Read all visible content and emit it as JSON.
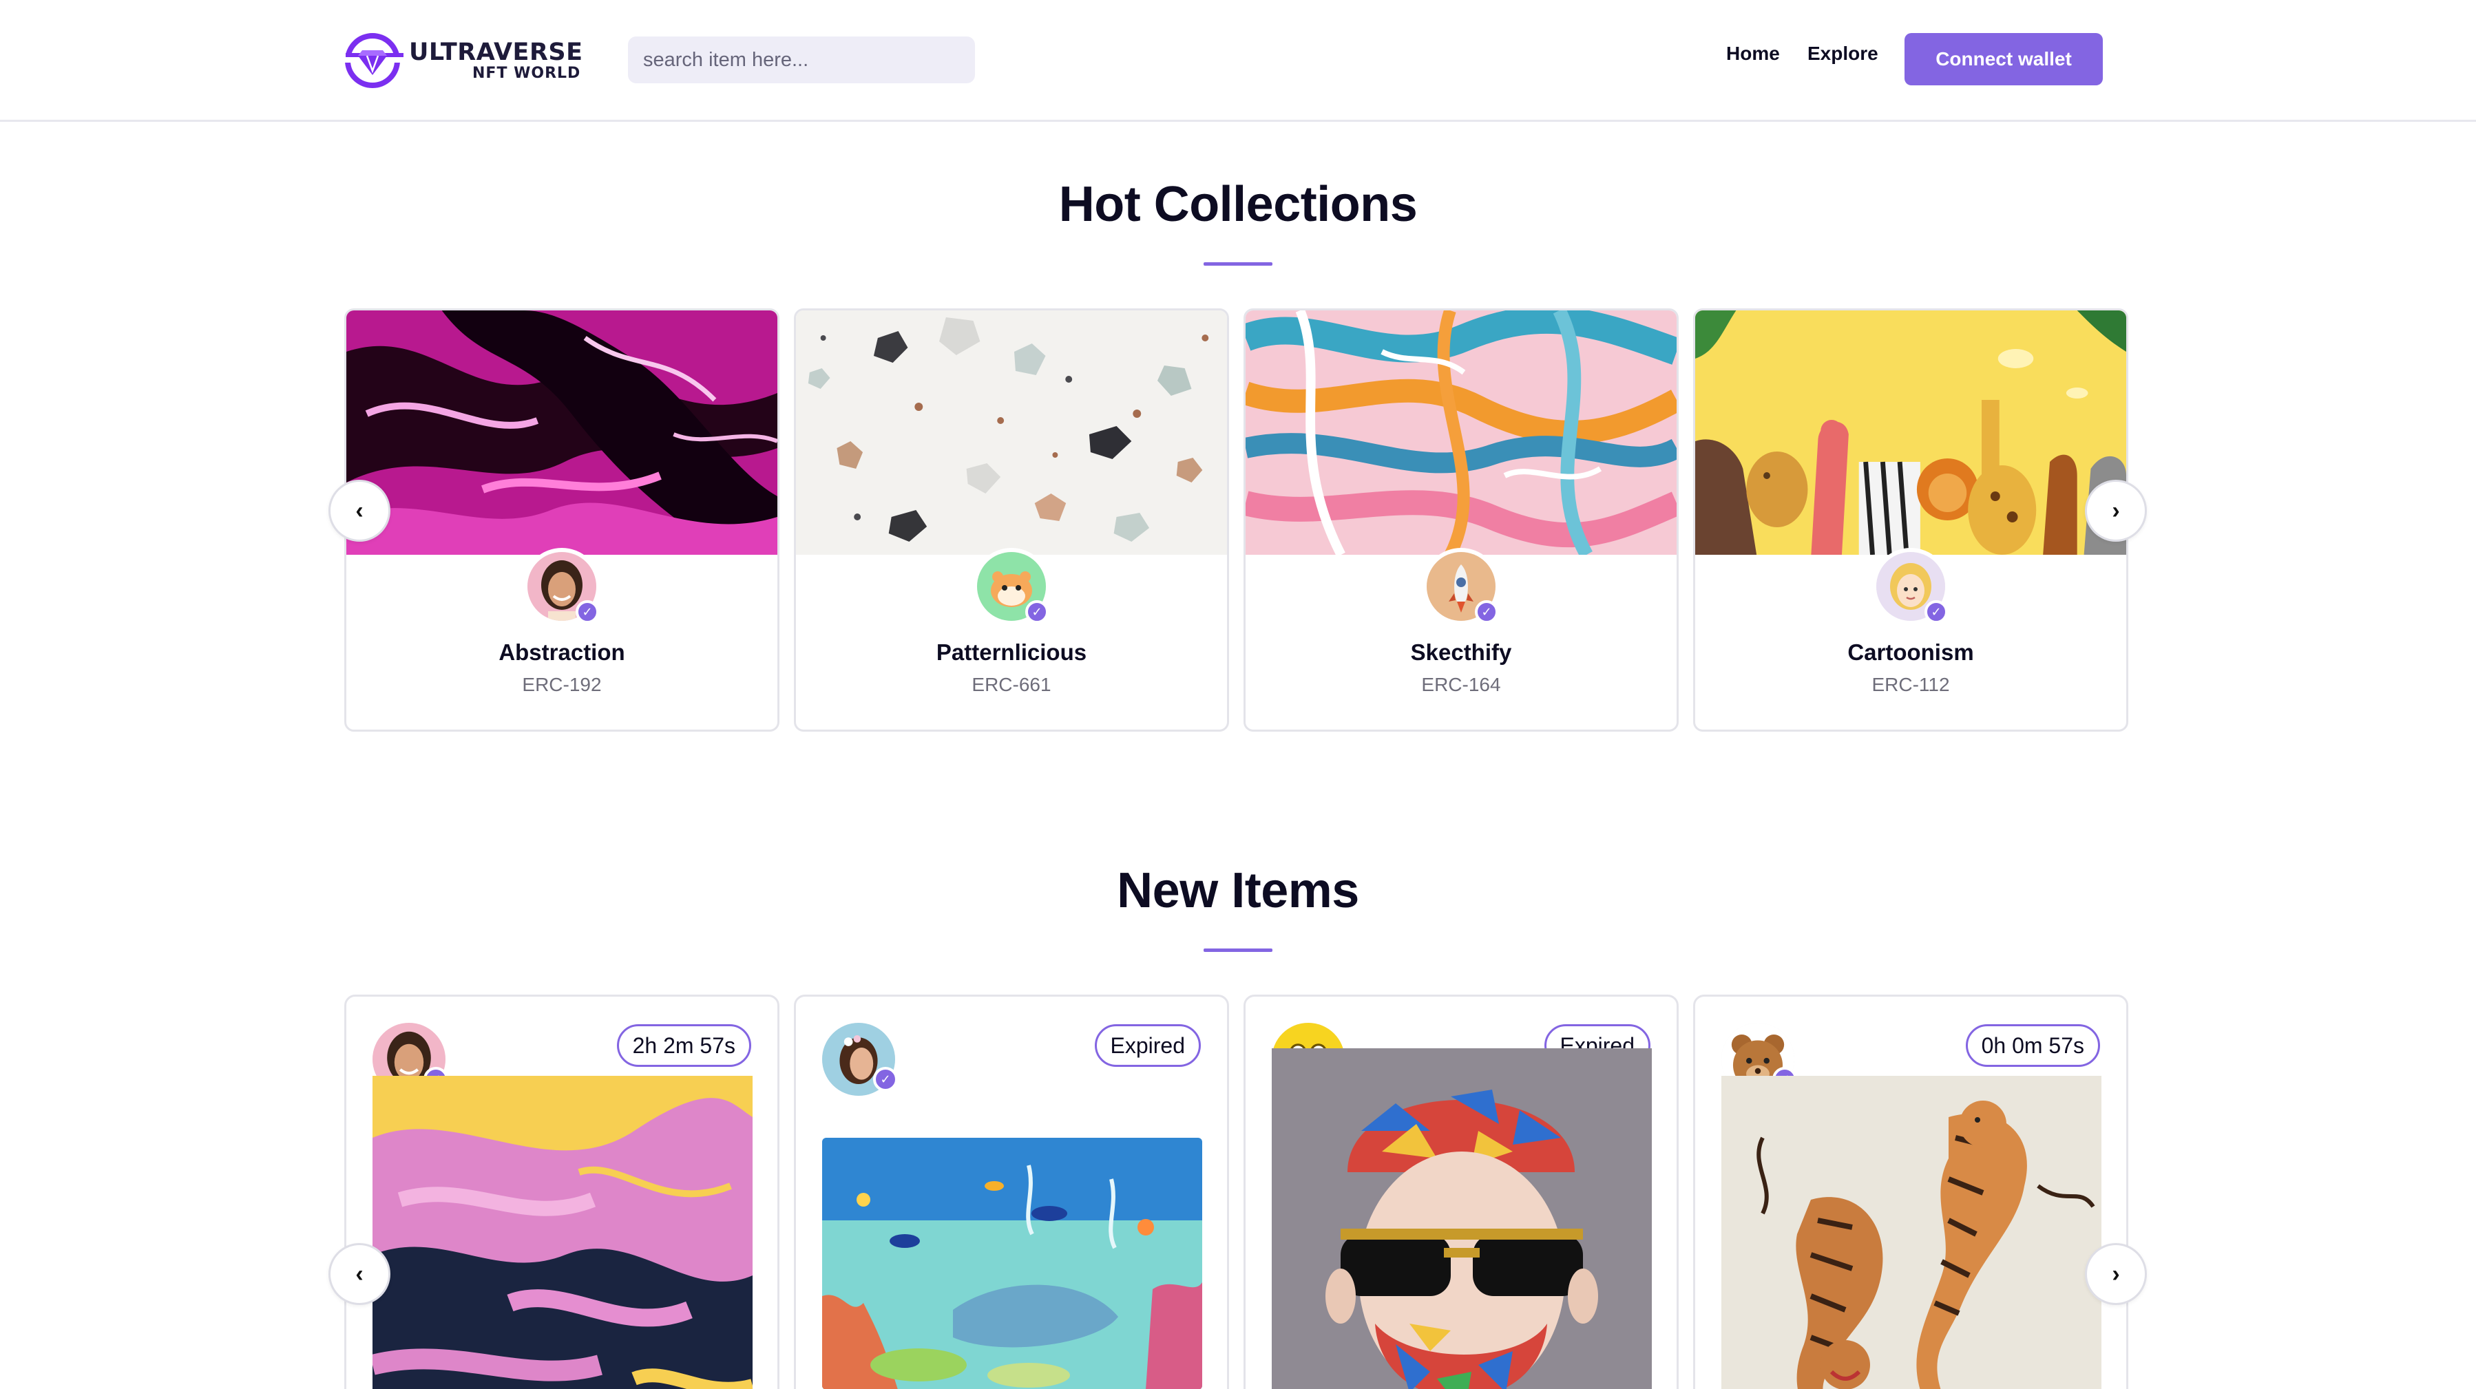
{
  "header": {
    "logo_line1": "ULTRAVERSE",
    "logo_line2": "NFT WORLD",
    "search_placeholder": "search item here...",
    "nav": {
      "home": "Home",
      "explore": "Explore"
    },
    "connect_label": "Connect wallet"
  },
  "hot_collections": {
    "title": "Hot Collections",
    "prev_icon": "‹",
    "next_icon": "›",
    "items": [
      {
        "name": "Abstraction",
        "code": "ERC-192",
        "banner_icon": "magenta-fluid-art",
        "verified": true
      },
      {
        "name": "Patternlicious",
        "code": "ERC-661",
        "banner_icon": "terrazzo-pattern",
        "verified": true
      },
      {
        "name": "Skecthify",
        "code": "ERC-164",
        "banner_icon": "brush-stroke-art",
        "verified": true
      },
      {
        "name": "Cartoonism",
        "code": "ERC-112",
        "banner_icon": "cartoon-animals",
        "verified": true
      }
    ]
  },
  "new_items": {
    "title": "New Items",
    "prev_icon": "‹",
    "next_icon": "›",
    "items": [
      {
        "countdown": "2h 2m 57s",
        "image_icon": "pink-yellow-marble-art",
        "verified": true
      },
      {
        "countdown": "Expired",
        "image_icon": "underwater-scene",
        "verified": true
      },
      {
        "countdown": "Expired",
        "image_icon": "mosaic-bearded-man",
        "verified": true
      },
      {
        "countdown": "0h 0m 57s",
        "image_icon": "two-tigers",
        "verified": true
      }
    ]
  },
  "colors": {
    "accent": "#8365e2",
    "text": "#0d0c22",
    "muted": "#6e6d7a",
    "border": "#e4e4ea",
    "search_bg": "#eeedf7"
  },
  "verify_icon": "✓"
}
